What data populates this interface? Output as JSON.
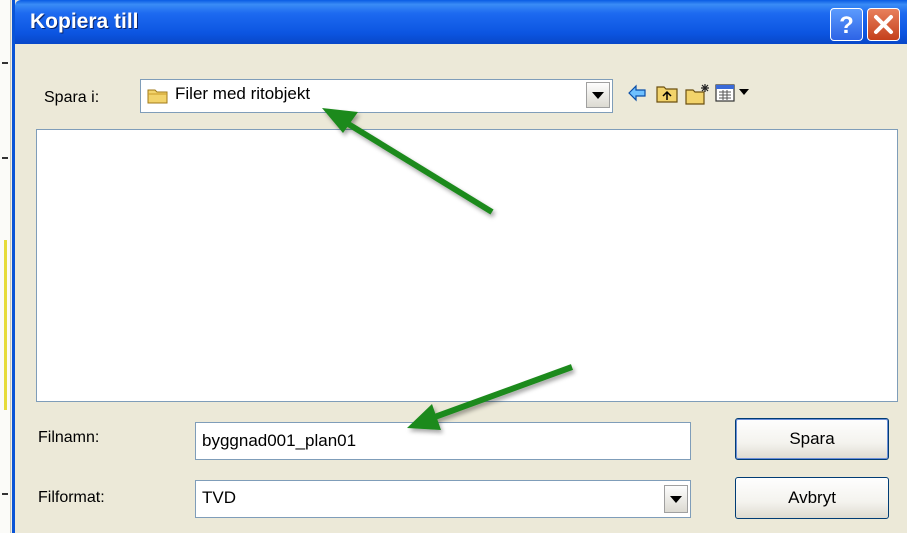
{
  "dialog": {
    "title": "Kopiera till"
  },
  "save_in": {
    "label": "Spara i:",
    "value": "Filer med ritobjekt"
  },
  "toolbar": {
    "back_icon": "back-arrow-icon",
    "up_icon": "up-folder-icon",
    "new_folder_icon": "new-folder-icon",
    "view_icon": "view-menu-icon"
  },
  "filename": {
    "label": "Filnamn:",
    "value": "byggnad001_plan01"
  },
  "fileformat": {
    "label": "Filformat:",
    "value": "TVD"
  },
  "buttons": {
    "save": "Spara",
    "cancel": "Avbryt"
  },
  "colors": {
    "titlebar": "#0c55e1",
    "annotation_arrow": "#1e8a1e"
  }
}
